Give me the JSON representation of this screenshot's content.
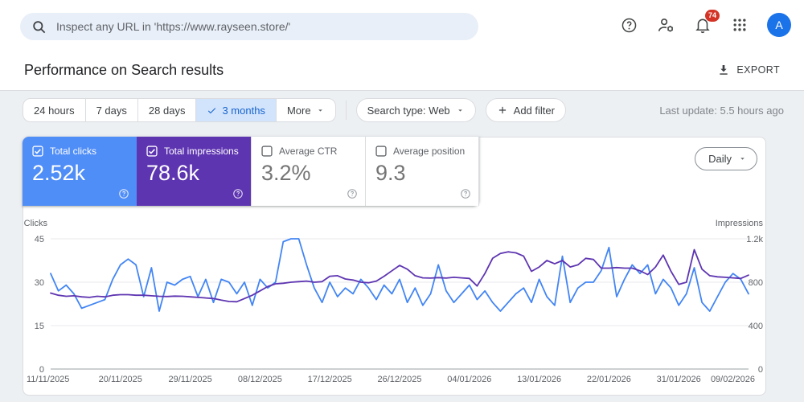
{
  "header": {
    "search_placeholder": "Inspect any URL in 'https://www.rayseen.store/'",
    "notification_count": "74",
    "avatar_letter": "A"
  },
  "title_bar": {
    "title": "Performance on Search results",
    "export_label": "EXPORT"
  },
  "filters": {
    "ranges": [
      "24 hours",
      "7 days",
      "28 days",
      "3 months"
    ],
    "selected_range": "3 months",
    "more_label": "More",
    "search_type_label": "Search type: Web",
    "add_filter_label": "Add filter",
    "last_update": "Last update: 5.5 hours ago"
  },
  "metrics": {
    "granularity": "Daily",
    "cards": [
      {
        "label": "Total clicks",
        "value": "2.52k",
        "selected": true,
        "color": "#4f8df7"
      },
      {
        "label": "Total impressions",
        "value": "78.6k",
        "selected": true,
        "color": "#5e35b1"
      },
      {
        "label": "Average CTR",
        "value": "3.2%",
        "selected": false
      },
      {
        "label": "Average position",
        "value": "9.3",
        "selected": false
      }
    ]
  },
  "colors": {
    "clicks_blue": "#4285f4",
    "impressions_purple": "#5e35b1",
    "selected_chip_bg": "#d2e3fc",
    "selected_chip_text": "#1765cf",
    "badge_red": "#d33426",
    "avatar_blue": "#1a73e8"
  },
  "chart_data": {
    "type": "line",
    "title": "Performance on Search results",
    "grid": true,
    "legend_position": "none",
    "x_tick_labels": [
      "11/11/2025",
      "20/11/2025",
      "29/11/2025",
      "08/12/2025",
      "17/12/2025",
      "26/12/2025",
      "04/01/2026",
      "13/01/2026",
      "22/01/2026",
      "31/01/2026",
      "09/02/2026"
    ],
    "left_axis": {
      "label": "Clicks",
      "ticks": [
        "45",
        "30",
        "15",
        "0"
      ],
      "max": 45,
      "min": 0
    },
    "right_axis": {
      "label": "Impressions",
      "ticks": [
        "1.2k",
        "800",
        "400",
        "0"
      ],
      "max": 1200,
      "min": 0
    },
    "series": [
      {
        "name": "Clicks",
        "axis": "left",
        "color": "#4285f4",
        "values": [
          33,
          27,
          29,
          26,
          21,
          22,
          23,
          24,
          31,
          36,
          38,
          36,
          25,
          35,
          20,
          30,
          29,
          31,
          32,
          25,
          31,
          23,
          31,
          30,
          26,
          30,
          22,
          31,
          28,
          30,
          44,
          45,
          45,
          36,
          28,
          23,
          30,
          25,
          28,
          26,
          31,
          28,
          24,
          29,
          26,
          31,
          23,
          28,
          22,
          26,
          36,
          27,
          23,
          26,
          29,
          24,
          27,
          23,
          20,
          23,
          26,
          28,
          23,
          31,
          25,
          22,
          39,
          23,
          28,
          30,
          30,
          34,
          42,
          25,
          31,
          36,
          33,
          36,
          26,
          31,
          28,
          22,
          26,
          35,
          23,
          20,
          25,
          30,
          33,
          31,
          26
        ]
      },
      {
        "name": "Impressions",
        "axis": "right",
        "color": "#5e35b1",
        "values": [
          700,
          680,
          670,
          675,
          665,
          660,
          670,
          665,
          680,
          685,
          685,
          680,
          680,
          675,
          670,
          668,
          672,
          670,
          665,
          660,
          655,
          650,
          635,
          622,
          620,
          650,
          680,
          720,
          760,
          785,
          790,
          800,
          805,
          810,
          800,
          805,
          855,
          860,
          830,
          820,
          800,
          795,
          810,
          855,
          905,
          955,
          920,
          860,
          840,
          838,
          842,
          838,
          845,
          840,
          835,
          765,
          880,
          1020,
          1065,
          1080,
          1070,
          1040,
          900,
          940,
          1000,
          970,
          1000,
          940,
          960,
          1020,
          1010,
          930,
          930,
          935,
          930,
          930,
          905,
          870,
          940,
          1050,
          900,
          780,
          800,
          1100,
          920,
          860,
          850,
          845,
          840,
          835,
          865
        ]
      }
    ]
  }
}
